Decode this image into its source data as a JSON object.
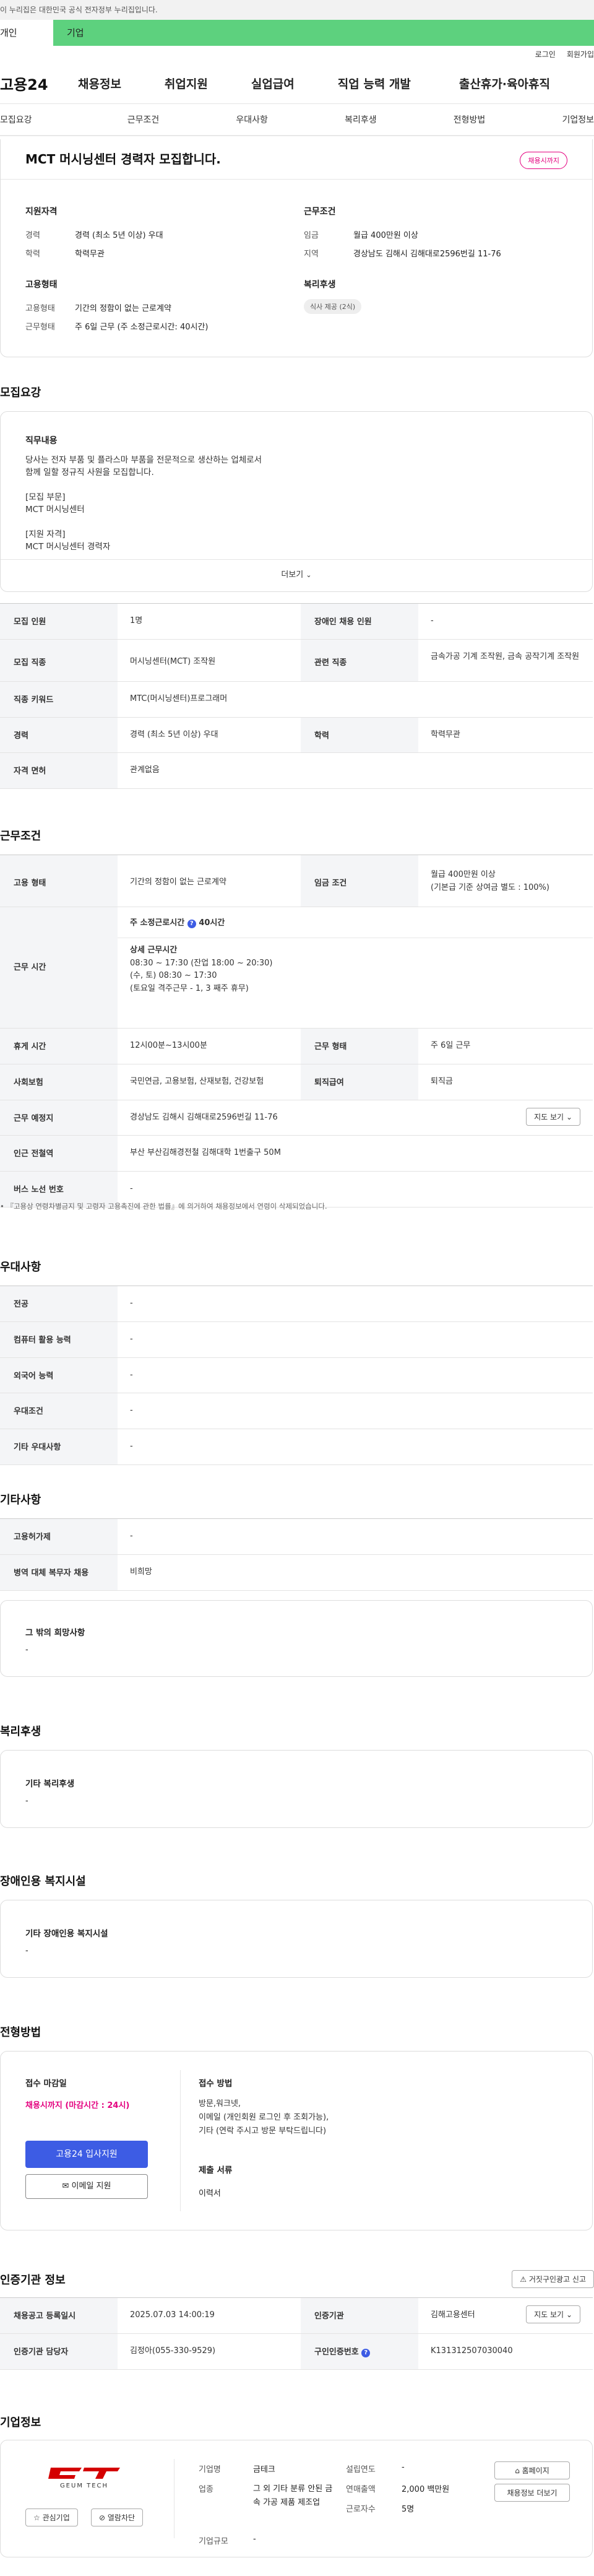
{
  "gov_banner": "이 누리집은 대한민국 공식 전자정부 누리집입니다.",
  "top_tabs": [
    "개인",
    "기업"
  ],
  "util": [
    "로그인",
    "회원가입"
  ],
  "logo": "고용24",
  "gnb": [
    "채용정보",
    "취업지원",
    "실업급여",
    "직업 능력 개발",
    "출산휴가·육아휴직"
  ],
  "subnav": [
    "모집요강",
    "근무조건",
    "우대사항",
    "복리후생",
    "전형방법",
    "기업정보"
  ],
  "summary": {
    "title": "MCT 머시닝센터 경력자 모집합니다.",
    "status": "채용시까지",
    "qual_h": "지원자격",
    "cond_h": "근무조건",
    "career_l": "경력",
    "career_v": "경력 (최소 5년 이상) 우대",
    "edu_l": "학력",
    "edu_v": "학력무관",
    "wage_l": "임금",
    "wage_v": "월급 400만원 이상",
    "loc_l": "지역",
    "loc_v": "경상남도 김해시 김해대로2596번길 11-76",
    "emp_h": "고용형태",
    "welfare_h": "복리후생",
    "type_l": "고용형태",
    "type_v": "기간의 정함이 없는 근로계약",
    "work_l": "근무형태",
    "work_v": "주 6일 근무 (주 소정근로시간: 40시간)",
    "welfare_v": "식사 제공 (2식)"
  },
  "recruit": {
    "title": "모집요강",
    "job_h": "직무내용",
    "job_lines": [
      "당사는 전자 부품 및 플라스마 부품을 전문적으로 생산하는 업체로서",
      "함께 일할 정규직 사원을 모집합니다.",
      "",
      "[모집 부문]",
      "MCT 머시닝센터",
      "",
      "[지원 자격]",
      "MCT 머시닝센터 경력자"
    ],
    "more": "더보기",
    "rows": [
      [
        "모집 인원",
        "1명",
        "장애인 채용 인원",
        "-"
      ],
      [
        "모집 직종",
        "머시닝센터(MCT) 조작원",
        "관련 직종",
        "금속가공 기계 조작원, 금속 공작기계 조작원"
      ],
      [
        "직종 키워드",
        "MTC(머시닝센터)프로그래머"
      ],
      [
        "경력",
        "경력 (최소 5년 이상) 우대",
        "학력",
        "학력무관"
      ],
      [
        "자격 면허",
        "관계없음"
      ]
    ]
  },
  "work": {
    "title": "근무조건",
    "emp_type_h": "고용 형태",
    "emp_type_v": "기간의 정함이 없는 근로계약",
    "wage_h": "임금 조건",
    "wage_v1": "월급 400만원 이상",
    "wage_v2": "(기본급 기준 상여금 별도 : 100%)",
    "hours_h": "근무 시간",
    "hours_total": "주 소정근로시간",
    "hours_total_v": "40시간",
    "hours_detail_h": "상세 근무시간",
    "hours_lines": [
      "08:30 ~ 17:30 (잔업 18:00 ~ 20:30)",
      "(수, 토) 08:30 ~ 17:30",
      "(토요일 격주근무 - 1, 3 째주 휴무)"
    ],
    "break_h": "휴게 시간",
    "break_v": "12시00분~13시00분",
    "form_h": "근무 형태",
    "form_v": "주 6일 근무",
    "ins_h": "사회보험",
    "ins_v": "국민연금, 고용보험, 산재보험, 건강보험",
    "sev_h": "퇴직급여",
    "sev_v": "퇴직금",
    "place_h": "근무 예정지",
    "place_v": "경상남도 김해시 김해대로2596번길 11-76",
    "map_btn": "지도 보기",
    "station_h": "인근 전철역",
    "station_v": "부산 부산김해경전철 김해대학 1번출구 50M",
    "bus_h": "버스 노선 번호",
    "bus_v": "-",
    "notice": "『고용상 연령차별금지 및 고령자 고용촉진에 관한 법률』에 의거하여 채용정보에서 연령이 삭제되었습니다."
  },
  "pref": {
    "title": "우대사항",
    "rows": [
      [
        "전공",
        "-"
      ],
      [
        "컴퓨터 활용 능력",
        "-"
      ],
      [
        "외국어 능력",
        "-"
      ],
      [
        "우대조건",
        "-"
      ],
      [
        "기타 우대사항",
        "-"
      ]
    ]
  },
  "etc": {
    "title": "기타사항",
    "rows": [
      [
        "고용허가제",
        "-"
      ],
      [
        "병역 대체 복무자 채용",
        "비희망"
      ]
    ],
    "other_h": "그 밖의 희망사항",
    "other_v": "-"
  },
  "welfare": {
    "title": "복리후생",
    "box_h": "기타 복리후생",
    "box_v": "-"
  },
  "disabled": {
    "title": "장애인용 복지시설",
    "box_h": "기타 장애인용 복지시설",
    "box_v": "-"
  },
  "process": {
    "title": "전형방법",
    "deadline_h": "접수 마감일",
    "deadline_v": "채용시까지 (마감시간 : 24시)",
    "apply_btn": "고용24 입사지원",
    "email_btn": "이메일 지원",
    "method_h": "접수 방법",
    "method_lines": [
      "방문,워크넷,",
      "이메일 (개인회원 로그인 후 조회가능),",
      "기타 (연락 주시고 방문 부탁드립니다)"
    ],
    "docs_h": "제출 서류",
    "docs_v": "이력서"
  },
  "agency": {
    "title": "인증기관 정보",
    "report_btn": "거짓구인광고 신고",
    "reg_h": "채용공고 등록일시",
    "reg_v": "2025.07.03 14:00:19",
    "org_h": "인증기관",
    "org_v": "김해고용센터",
    "map_btn": "지도 보기",
    "mgr_h": "인증기관 담당자",
    "mgr_v": "김정아(055-330-9529)",
    "num_h": "구인인증번호",
    "num_v": "K131312507030040"
  },
  "company": {
    "title": "기업정보",
    "logo_text": "GEUM TECH",
    "fav_btn": "관심기업",
    "block_btn": "열람차단",
    "name_l": "기업명",
    "name_v": "금테크",
    "ind_l": "업종",
    "ind_v": "그 외 기타 분류 안된 금속 가공 제품 제조업",
    "size_l": "기업규모",
    "size_v": "-",
    "year_l": "설립연도",
    "year_v": "-",
    "sales_l": "연매출액",
    "sales_v": "2,000 백만원",
    "emp_l": "근로자수",
    "emp_v": "5명",
    "home_btn": "홈페이지",
    "more_btn": "채용정보 더보기"
  },
  "colors": {
    "brand_green": "#5dd17e",
    "accent_red": "#e4007f",
    "apply_blue": "#3d5ce4"
  }
}
